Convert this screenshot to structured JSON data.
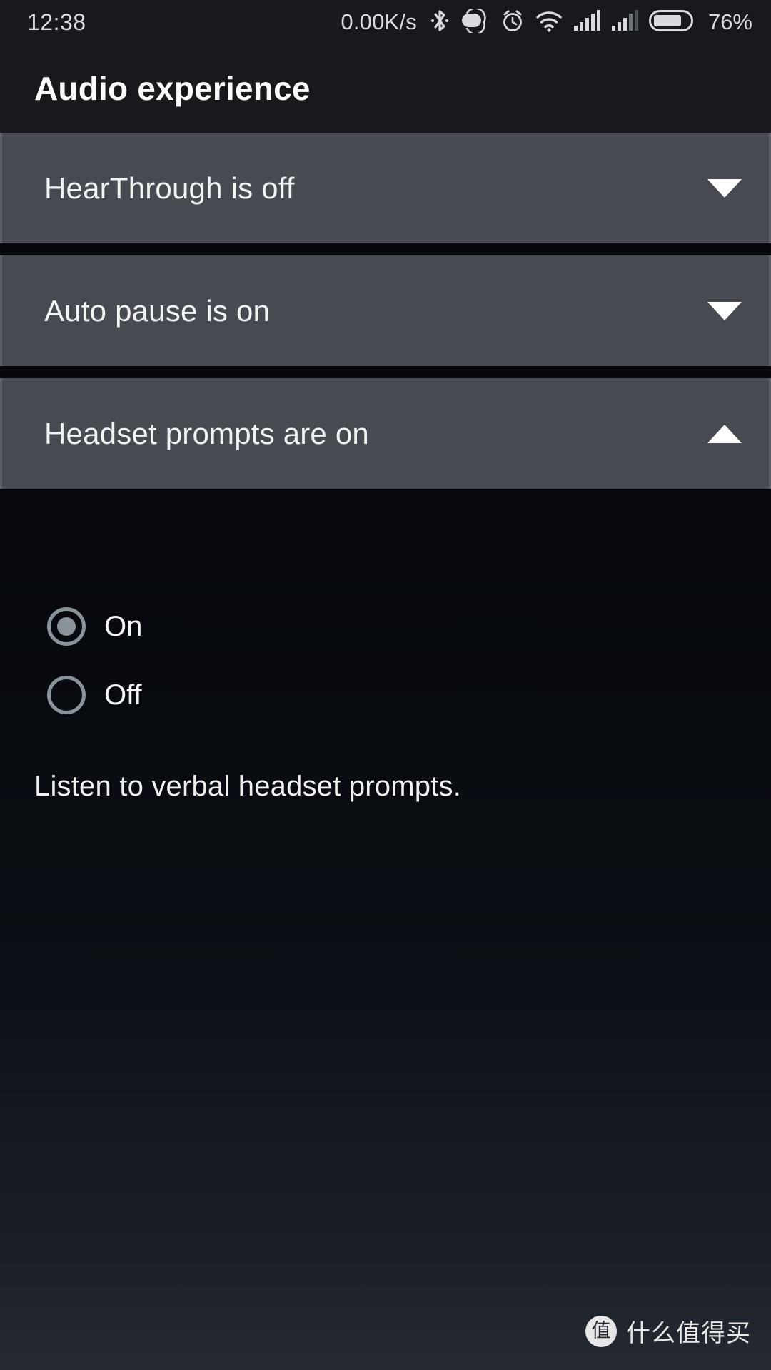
{
  "status_bar": {
    "time": "12:38",
    "network_speed": "0.00K/s",
    "battery_percent": "76%",
    "icons": [
      {
        "name": "bluetooth-icon"
      },
      {
        "name": "vibrate-mode-icon"
      },
      {
        "name": "alarm-clock-icon"
      },
      {
        "name": "wifi-icon"
      },
      {
        "name": "signal-sim1-icon"
      },
      {
        "name": "signal-sim2-icon"
      },
      {
        "name": "battery-icon"
      }
    ],
    "battery_level": 76
  },
  "header": {
    "title": "Audio experience"
  },
  "cards": [
    {
      "label": "HearThrough is off",
      "arrow": "chevron-down",
      "expanded": false
    },
    {
      "label": "Auto pause is on",
      "arrow": "chevron-down",
      "expanded": false
    },
    {
      "label": "Headset prompts are on",
      "arrow": "chevron-up",
      "expanded": true
    }
  ],
  "expanded_panel": {
    "options": [
      {
        "label": "On",
        "selected": true
      },
      {
        "label": "Off",
        "selected": false
      }
    ],
    "description": "Listen to verbal headset prompts."
  },
  "watermark": {
    "logo_char": "值",
    "text": "什么值得买"
  },
  "colors": {
    "card_background": "#474b51",
    "card_edge": "#5d6167",
    "status_background": "#17191c",
    "text_primary": "#f5f5f5",
    "radio_accent": "#8b939a",
    "page_background": "#060809"
  }
}
